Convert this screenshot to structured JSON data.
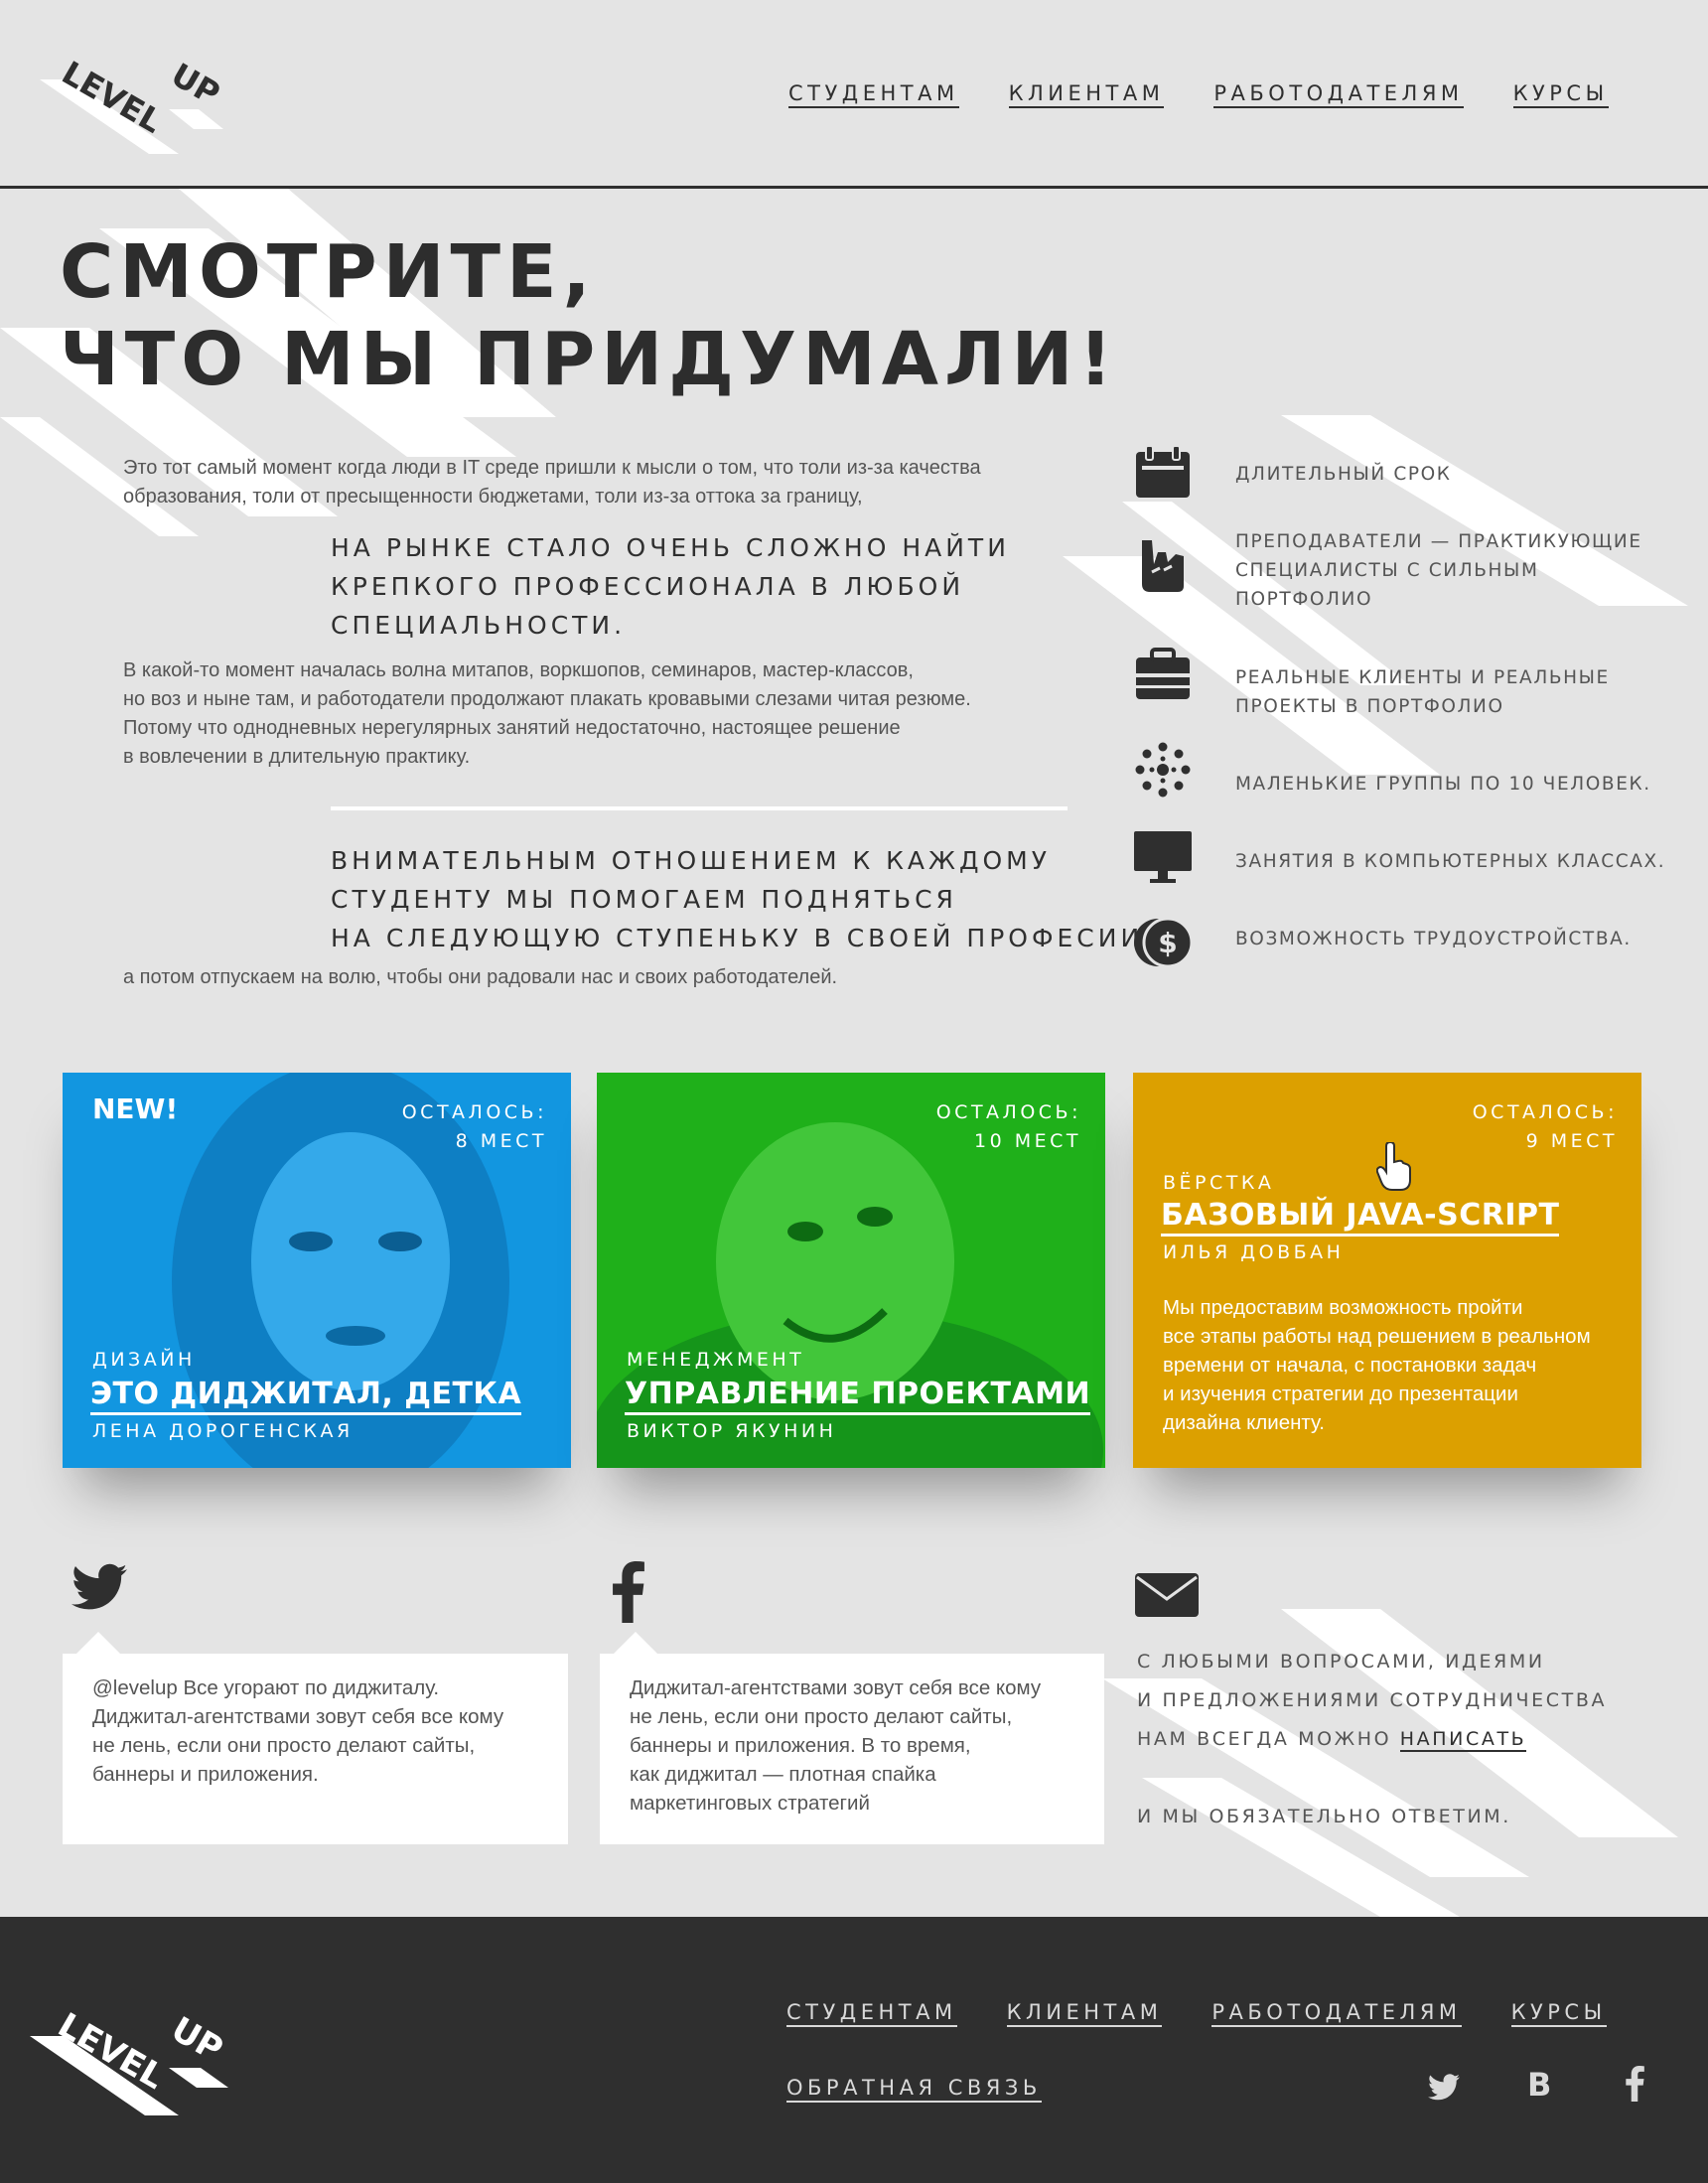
{
  "logo": {
    "line1": "LEVEL",
    "line2": "UP"
  },
  "nav": [
    "СТУДЕНТАМ",
    "КЛИЕНТАМ",
    "РАБОТОДАТЕЛЯМ",
    "КУРСЫ"
  ],
  "hero": {
    "title_line1": "СМОТРИТЕ,",
    "title_line2": "ЧТО МЫ ПРИДУМАЛИ!",
    "intro_line1": "Это тот самый момент когда люди в IT среде пришли к мысли о том, что толи из-за качества",
    "intro_line2": "образования, толи от пресыщенности бюджетами, толи из-за оттока за границу,",
    "quote1_line1": "НА РЫНКЕ СТАЛО ОЧЕНЬ СЛОЖНО НАЙТИ",
    "quote1_line2": "КРЕПКОГО ПРОФЕССИОНАЛА В ЛЮБОЙ",
    "quote1_line3": "СПЕЦИАЛЬНОСТИ.",
    "body_line1": "В какой-то момент началась волна митапов, воркшопов, семинаров, мастер-классов,",
    "body_line2": "но воз и ныне там, и работодатели продолжают плакать кровавыми слезами читая резюме.",
    "body_line3": "Потому что однодневных нерегулярных занятий недостаточно, настоящее решение",
    "body_line4": "в вовлечении в длительную практику.",
    "quote2_line1": "ВНИМАТЕЛЬНЫМ ОТНОШЕНИЕМ К КАЖДОМУ",
    "quote2_line2": "СТУДЕНТУ МЫ ПОМОГАЕМ ПОДНЯТЬСЯ",
    "quote2_line3": "НА СЛЕДУЮЩУЮ СТУПЕНЬКУ В СВОЕЙ ПРОФЕСИИ,",
    "outro": "а потом отпускаем на волю, чтобы они радовали нас и своих работодателей."
  },
  "features": [
    {
      "icon": "calendar-icon",
      "lines": [
        "ДЛИТЕЛЬНЫЙ СРОК"
      ]
    },
    {
      "icon": "rock-hand-icon",
      "lines": [
        "ПРЕПОДАВАТЕЛИ — ПРАКТИКУЮЩИЕ",
        "СПЕЦИАЛИСТЫ С СИЛЬНЫМ",
        "ПОРТФОЛИО"
      ]
    },
    {
      "icon": "briefcase-icon",
      "lines": [
        "РЕАЛЬНЫЕ КЛИЕНТЫ И РЕАЛЬНЫЕ",
        "ПРОЕКТЫ В ПОРТФОЛИО"
      ]
    },
    {
      "icon": "group-icon",
      "lines": [
        "МАЛЕНЬКИЕ ГРУППЫ ПО 10 ЧЕЛОВЕК."
      ]
    },
    {
      "icon": "monitor-icon",
      "lines": [
        "ЗАНЯТИЯ В КОМПЬЮТЕРНЫХ КЛАССАХ."
      ]
    },
    {
      "icon": "money-icon",
      "lines": [
        "ВОЗМОЖНОСТЬ  ТРУДОУСТРОЙСТВА."
      ]
    }
  ],
  "cards": [
    {
      "badge": "NEW!",
      "seats_label": "ОСТАЛОСЬ:",
      "seats": "8 МЕСТ",
      "category": "ДИЗАЙН",
      "title": "ЭТО ДИДЖИТАЛ, ДЕТКА",
      "author": "ЛЕНА ДОРОГЕНСКАЯ",
      "color": "#1296e0"
    },
    {
      "seats_label": "ОСТАЛОСЬ:",
      "seats": "10 МЕСТ",
      "category": "МЕНЕДЖМЕНТ",
      "title": "УПРАВЛЕНИЕ ПРОЕКТАМИ",
      "author": "ВИКТОР ЯКУНИН",
      "color": "#1fb01a"
    },
    {
      "seats_label": "ОСТАЛОСЬ:",
      "seats": "9 МЕСТ",
      "category": "ВЁРСТКА",
      "title": "БАЗОВЫЙ JAVA-SCRIPT",
      "author": "ИЛЬЯ ДОВБАН",
      "color": "#dca000",
      "desc_lines": [
        "Мы предоставим возможность пройти",
        "все этапы работы над решением в реальном",
        "времени от начала, с постановки задач",
        "и изучения стратегии до презентации",
        "дизайна клиенту."
      ]
    }
  ],
  "social": {
    "twitter_lines": [
      "@levelup Все угорают по диджиталу.",
      "Диджитал-агентствами зовут себя все кому",
      "не лень, если они просто делают сайты,",
      "баннеры и приложения."
    ],
    "facebook_lines": [
      "Диджитал-агентствами зовут себя все кому",
      "не лень, если они просто делают сайты,",
      "баннеры и приложения. В то время,",
      "как диджитал — плотная спайка",
      "маркетинговых стратегий"
    ],
    "contact_line1": "С ЛЮБЫМИ ВОПРОСАМИ, ИДЕЯМИ",
    "contact_line2": "И ПРЕДЛОЖЕНИЯМИ СОТРУДНИЧЕСТВА",
    "contact_line3": "НАМ ВСЕГДА МОЖНО ",
    "contact_link": "НАПИСАТЬ",
    "contact_line4": "И МЫ ОБЯЗАТЕЛЬНО ОТВЕТИМ."
  },
  "footer": {
    "nav": [
      "СТУДЕНТАМ",
      "КЛИЕНТАМ",
      "РАБОТОДАТЕЛЯМ",
      "КУРСЫ"
    ],
    "feedback": "ОБРАТНАЯ СВЯЗЬ",
    "vk_label": "B",
    "icons": [
      "twitter-icon",
      "vk-icon",
      "facebook-icon"
    ]
  },
  "colors": {
    "background": "#e4e4e4",
    "dark": "#2f2f2f",
    "blue": "#1296e0",
    "green": "#1fb01a",
    "gold": "#dca000"
  }
}
